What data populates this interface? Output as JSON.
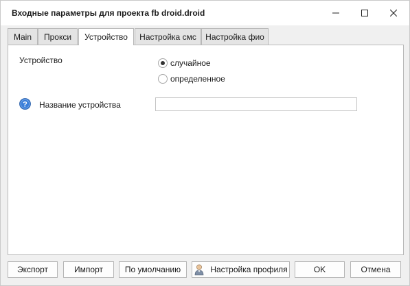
{
  "window": {
    "title": "Входные параметры для проекта fb droid.droid",
    "controls": {
      "minimize": "minimize-icon",
      "maximize": "maximize-icon",
      "close": "close-icon"
    }
  },
  "tabs": [
    {
      "label": "Main",
      "active": false
    },
    {
      "label": "Прокси",
      "active": false
    },
    {
      "label": "Устройство",
      "active": true
    },
    {
      "label": "Настройка смс",
      "active": false
    },
    {
      "label": "Настройка фио",
      "active": false
    }
  ],
  "device_tab": {
    "device_label": "Устройство",
    "options": [
      {
        "label": "случайное",
        "selected": true
      },
      {
        "label": "определенное",
        "selected": false
      }
    ],
    "help_icon": "question-icon",
    "name_label": "Название устройства",
    "name_value": ""
  },
  "footer": {
    "export_label": "Экспорт",
    "import_label": "Импорт",
    "default_label": "По умолчанию",
    "profile_label": "Настройка профиля",
    "profile_icon": "user-icon",
    "ok_label": "OK",
    "cancel_label": "Отмена"
  },
  "colors": {
    "help_icon_fill": "#3b7fd9",
    "window_bg": "#f0f0f0",
    "panel_bg": "#ffffff"
  }
}
